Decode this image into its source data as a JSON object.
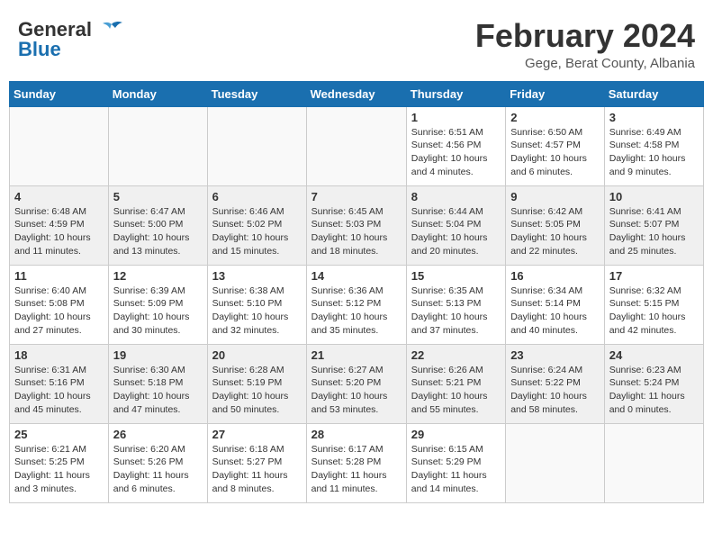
{
  "header": {
    "logo_line1": "General",
    "logo_line2": "Blue",
    "month_title": "February 2024",
    "location": "Gege, Berat County, Albania"
  },
  "days_of_week": [
    "Sunday",
    "Monday",
    "Tuesday",
    "Wednesday",
    "Thursday",
    "Friday",
    "Saturday"
  ],
  "weeks": [
    [
      {
        "day": "",
        "info": ""
      },
      {
        "day": "",
        "info": ""
      },
      {
        "day": "",
        "info": ""
      },
      {
        "day": "",
        "info": ""
      },
      {
        "day": "1",
        "info": "Sunrise: 6:51 AM\nSunset: 4:56 PM\nDaylight: 10 hours\nand 4 minutes."
      },
      {
        "day": "2",
        "info": "Sunrise: 6:50 AM\nSunset: 4:57 PM\nDaylight: 10 hours\nand 6 minutes."
      },
      {
        "day": "3",
        "info": "Sunrise: 6:49 AM\nSunset: 4:58 PM\nDaylight: 10 hours\nand 9 minutes."
      }
    ],
    [
      {
        "day": "4",
        "info": "Sunrise: 6:48 AM\nSunset: 4:59 PM\nDaylight: 10 hours\nand 11 minutes."
      },
      {
        "day": "5",
        "info": "Sunrise: 6:47 AM\nSunset: 5:00 PM\nDaylight: 10 hours\nand 13 minutes."
      },
      {
        "day": "6",
        "info": "Sunrise: 6:46 AM\nSunset: 5:02 PM\nDaylight: 10 hours\nand 15 minutes."
      },
      {
        "day": "7",
        "info": "Sunrise: 6:45 AM\nSunset: 5:03 PM\nDaylight: 10 hours\nand 18 minutes."
      },
      {
        "day": "8",
        "info": "Sunrise: 6:44 AM\nSunset: 5:04 PM\nDaylight: 10 hours\nand 20 minutes."
      },
      {
        "day": "9",
        "info": "Sunrise: 6:42 AM\nSunset: 5:05 PM\nDaylight: 10 hours\nand 22 minutes."
      },
      {
        "day": "10",
        "info": "Sunrise: 6:41 AM\nSunset: 5:07 PM\nDaylight: 10 hours\nand 25 minutes."
      }
    ],
    [
      {
        "day": "11",
        "info": "Sunrise: 6:40 AM\nSunset: 5:08 PM\nDaylight: 10 hours\nand 27 minutes."
      },
      {
        "day": "12",
        "info": "Sunrise: 6:39 AM\nSunset: 5:09 PM\nDaylight: 10 hours\nand 30 minutes."
      },
      {
        "day": "13",
        "info": "Sunrise: 6:38 AM\nSunset: 5:10 PM\nDaylight: 10 hours\nand 32 minutes."
      },
      {
        "day": "14",
        "info": "Sunrise: 6:36 AM\nSunset: 5:12 PM\nDaylight: 10 hours\nand 35 minutes."
      },
      {
        "day": "15",
        "info": "Sunrise: 6:35 AM\nSunset: 5:13 PM\nDaylight: 10 hours\nand 37 minutes."
      },
      {
        "day": "16",
        "info": "Sunrise: 6:34 AM\nSunset: 5:14 PM\nDaylight: 10 hours\nand 40 minutes."
      },
      {
        "day": "17",
        "info": "Sunrise: 6:32 AM\nSunset: 5:15 PM\nDaylight: 10 hours\nand 42 minutes."
      }
    ],
    [
      {
        "day": "18",
        "info": "Sunrise: 6:31 AM\nSunset: 5:16 PM\nDaylight: 10 hours\nand 45 minutes."
      },
      {
        "day": "19",
        "info": "Sunrise: 6:30 AM\nSunset: 5:18 PM\nDaylight: 10 hours\nand 47 minutes."
      },
      {
        "day": "20",
        "info": "Sunrise: 6:28 AM\nSunset: 5:19 PM\nDaylight: 10 hours\nand 50 minutes."
      },
      {
        "day": "21",
        "info": "Sunrise: 6:27 AM\nSunset: 5:20 PM\nDaylight: 10 hours\nand 53 minutes."
      },
      {
        "day": "22",
        "info": "Sunrise: 6:26 AM\nSunset: 5:21 PM\nDaylight: 10 hours\nand 55 minutes."
      },
      {
        "day": "23",
        "info": "Sunrise: 6:24 AM\nSunset: 5:22 PM\nDaylight: 10 hours\nand 58 minutes."
      },
      {
        "day": "24",
        "info": "Sunrise: 6:23 AM\nSunset: 5:24 PM\nDaylight: 11 hours\nand 0 minutes."
      }
    ],
    [
      {
        "day": "25",
        "info": "Sunrise: 6:21 AM\nSunset: 5:25 PM\nDaylight: 11 hours\nand 3 minutes."
      },
      {
        "day": "26",
        "info": "Sunrise: 6:20 AM\nSunset: 5:26 PM\nDaylight: 11 hours\nand 6 minutes."
      },
      {
        "day": "27",
        "info": "Sunrise: 6:18 AM\nSunset: 5:27 PM\nDaylight: 11 hours\nand 8 minutes."
      },
      {
        "day": "28",
        "info": "Sunrise: 6:17 AM\nSunset: 5:28 PM\nDaylight: 11 hours\nand 11 minutes."
      },
      {
        "day": "29",
        "info": "Sunrise: 6:15 AM\nSunset: 5:29 PM\nDaylight: 11 hours\nand 14 minutes."
      },
      {
        "day": "",
        "info": ""
      },
      {
        "day": "",
        "info": ""
      }
    ]
  ]
}
